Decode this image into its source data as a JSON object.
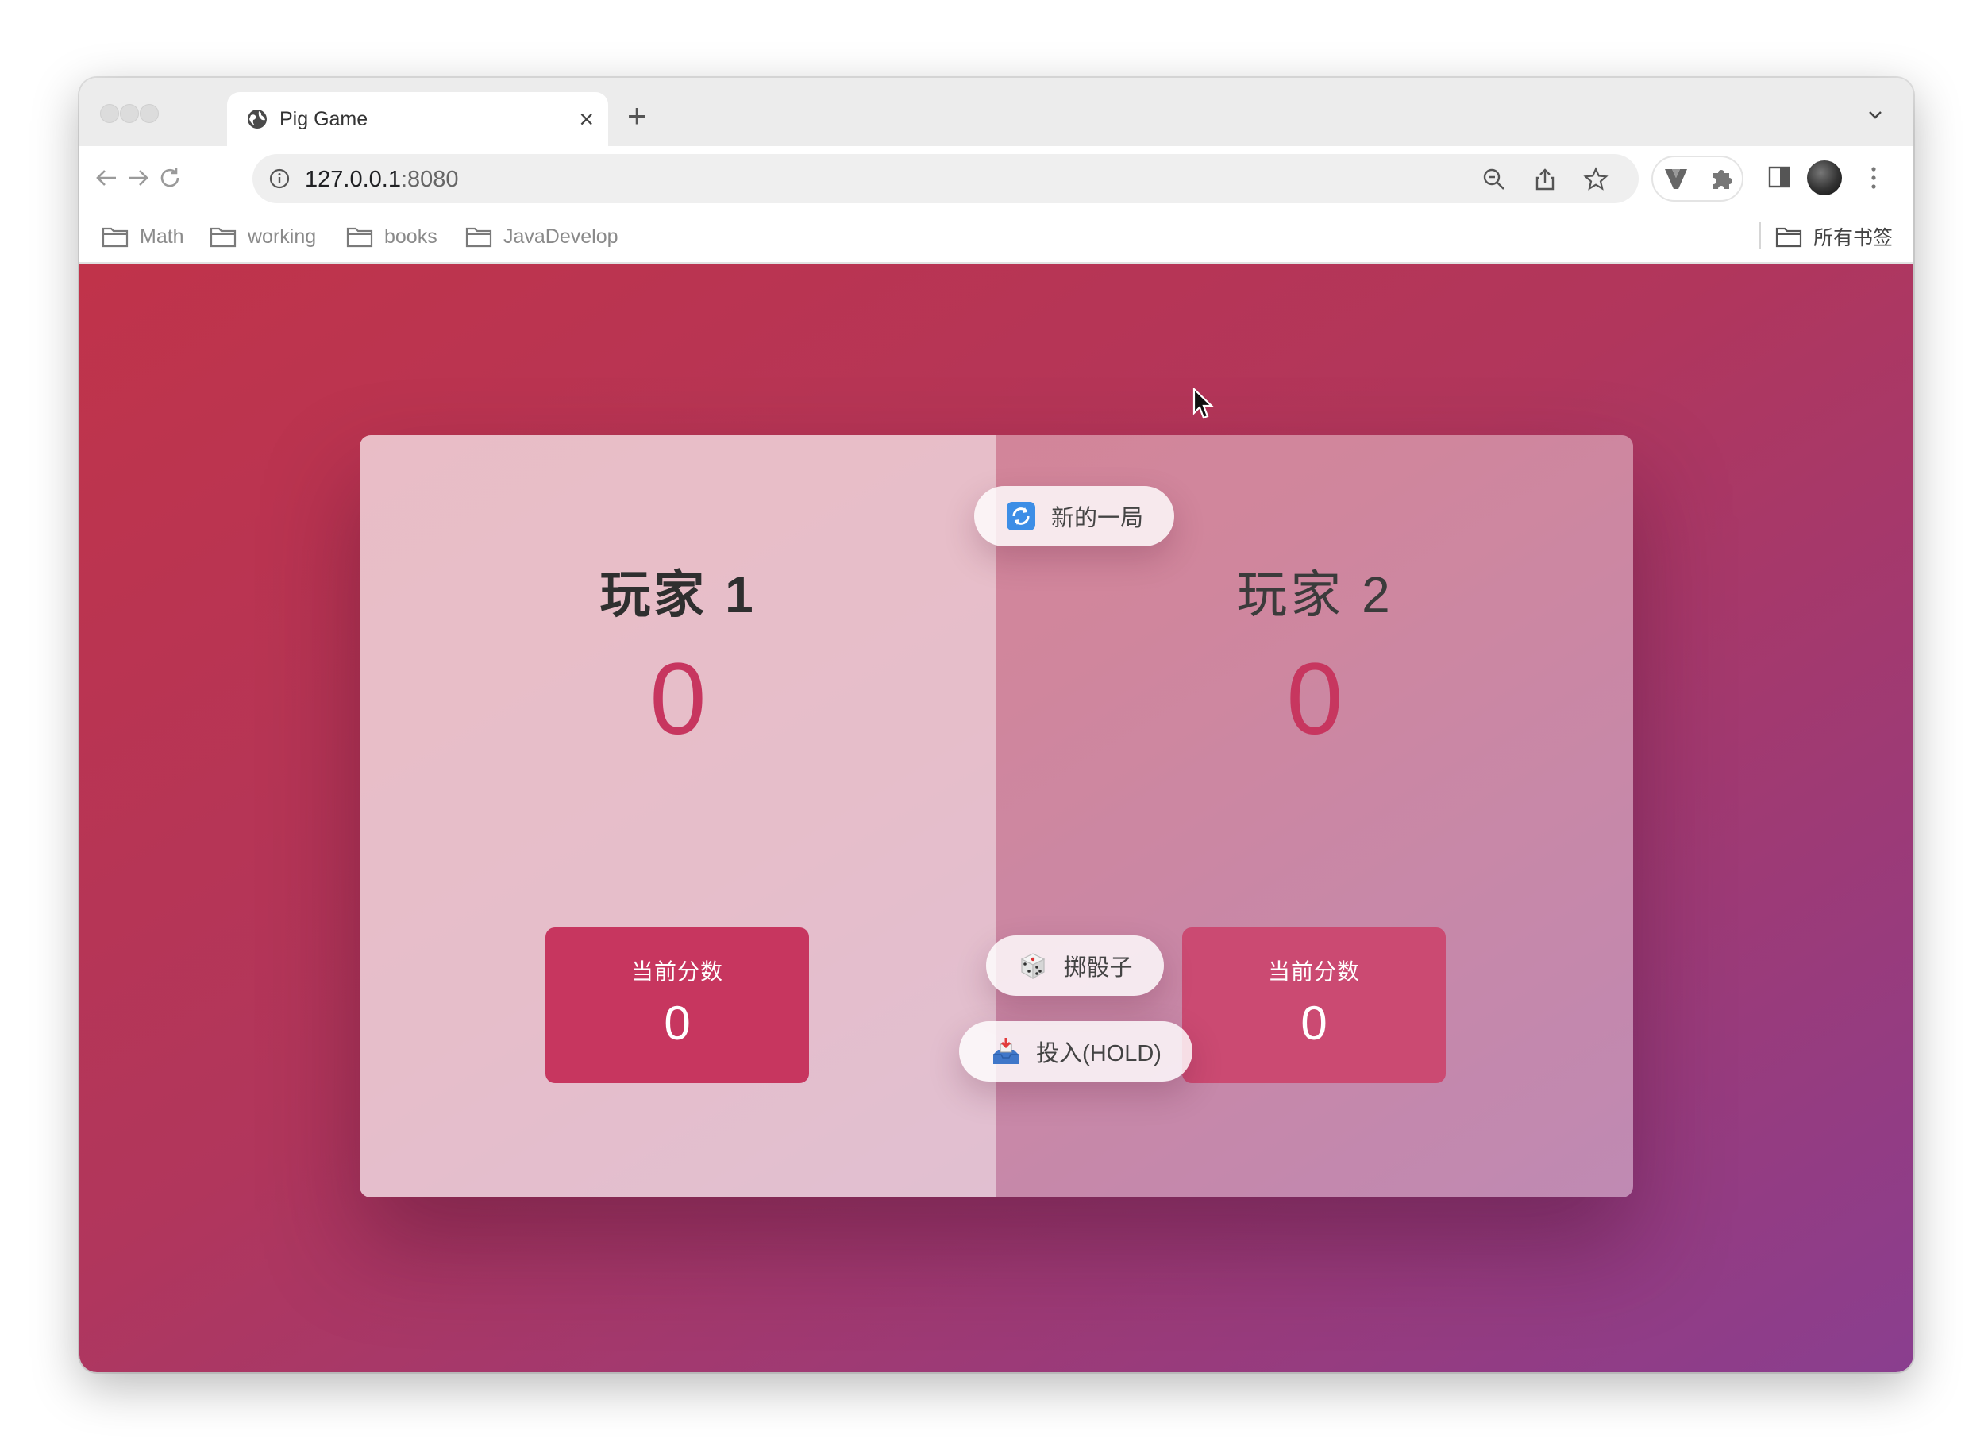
{
  "browser": {
    "tab_title": "Pig Game",
    "tab_close": "×",
    "new_tab": "+",
    "url_host": "127.0.0.1",
    "url_port": ":8080",
    "bookmarks": [
      {
        "label": "Math"
      },
      {
        "label": "working"
      },
      {
        "label": "books"
      },
      {
        "label": "JavaDevelop"
      }
    ],
    "all_bookmarks": "所有书签"
  },
  "game": {
    "new_game_label": "新的一局",
    "roll_label": "掷骰子",
    "hold_label": "投入(HOLD)",
    "players": [
      {
        "name": "玩家 1",
        "score": "0",
        "current_label": "当前分数",
        "current_score": "0",
        "active": true
      },
      {
        "name": "玩家 2",
        "score": "0",
        "current_label": "当前分数",
        "current_score": "0",
        "active": false
      }
    ]
  },
  "colors": {
    "accent": "#c7365f",
    "background_from": "#c0334a",
    "background_to": "#8a3e8f"
  },
  "icons": [
    "globe-icon",
    "back-icon",
    "forward-icon",
    "reload-icon",
    "site-info-icon",
    "zoom-icon",
    "share-icon",
    "star-icon",
    "extension-v-icon",
    "puzzle-icon",
    "sidepanel-icon",
    "kebab-icon",
    "folder-icon",
    "refresh-emoji-icon",
    "dice-emoji-icon",
    "inbox-emoji-icon"
  ]
}
